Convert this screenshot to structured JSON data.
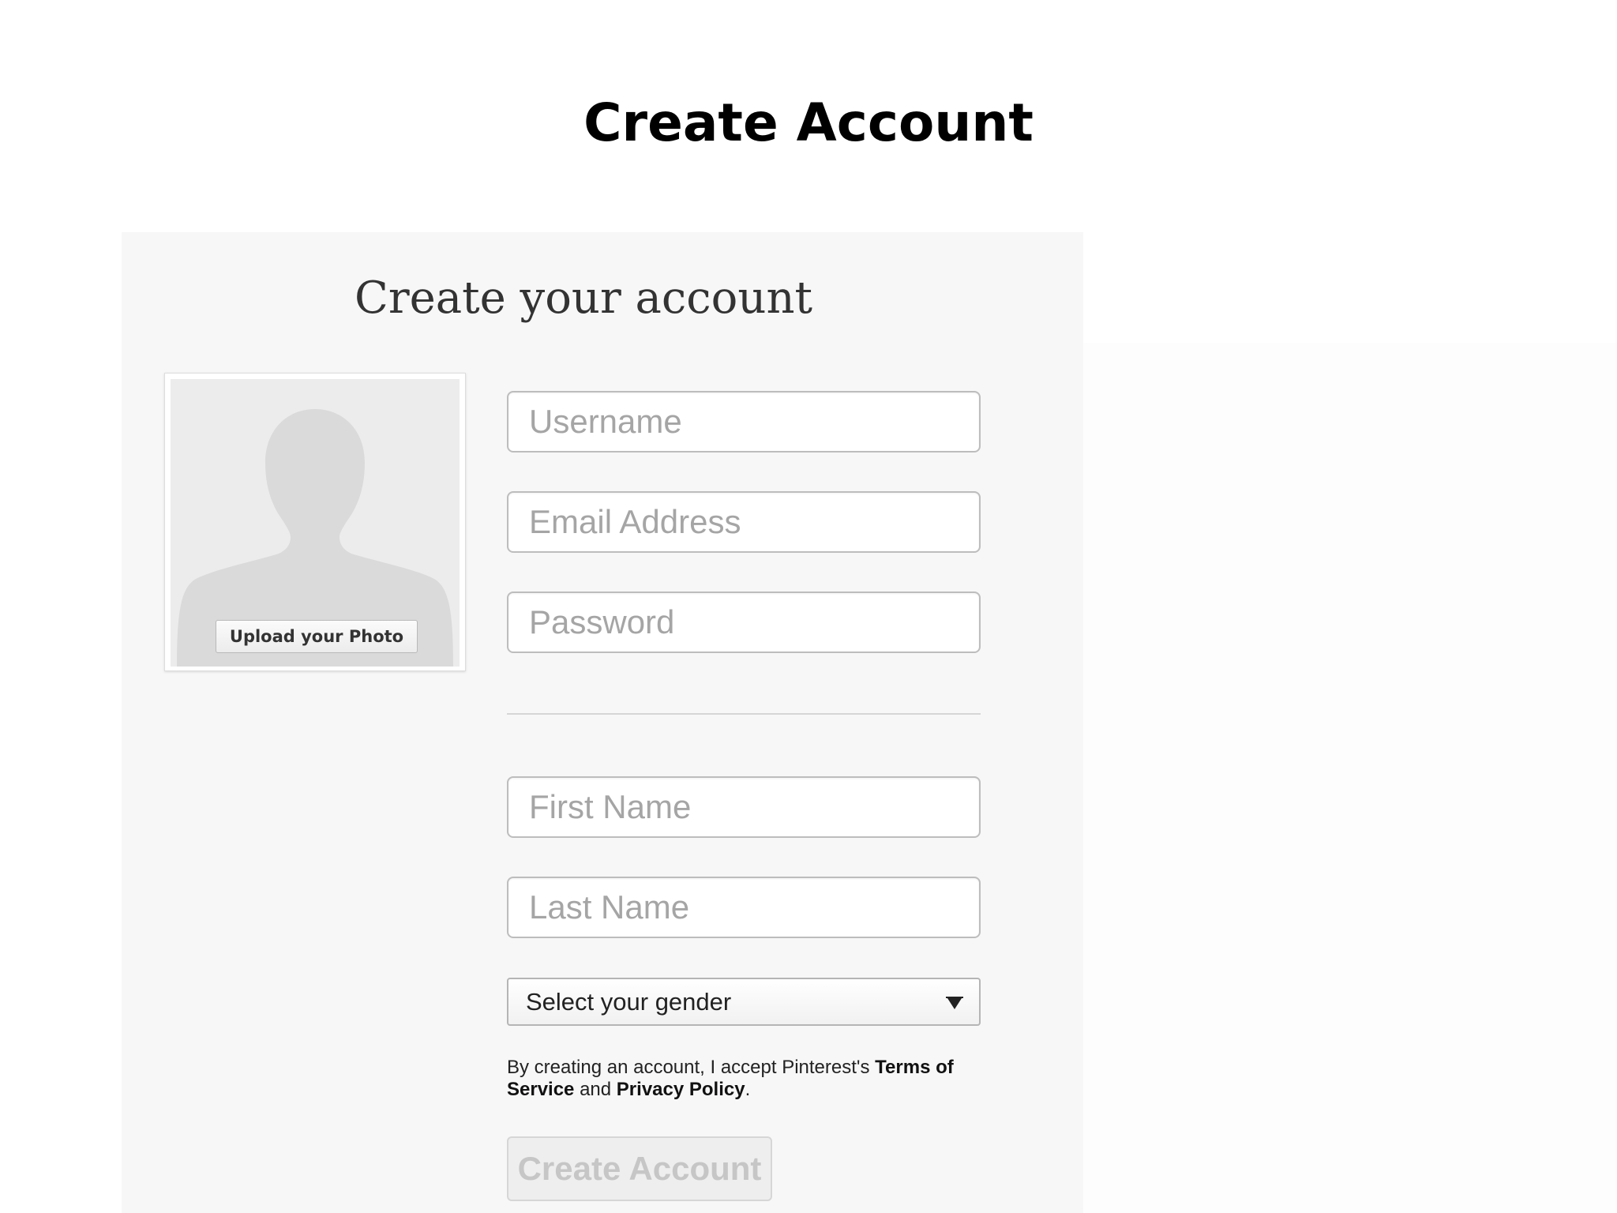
{
  "slide": {
    "title": "Create Account"
  },
  "form": {
    "heading": "Create your account",
    "photo": {
      "upload_label": "Upload your Photo",
      "placeholder_icon": "person-silhouette-icon"
    },
    "fields": {
      "username": {
        "placeholder": "Username",
        "value": ""
      },
      "email": {
        "placeholder": "Email Address",
        "value": ""
      },
      "password": {
        "placeholder": "Password",
        "value": ""
      },
      "first_name": {
        "placeholder": "First Name",
        "value": ""
      },
      "last_name": {
        "placeholder": "Last Name",
        "value": ""
      }
    },
    "gender": {
      "selected": "Select your gender",
      "icon": "dropdown-arrow-icon"
    },
    "terms": {
      "prefix": "By creating an account, I accept Pinterest's ",
      "terms_link": "Terms of Service",
      "joiner": " and ",
      "privacy_link": "Privacy Policy",
      "suffix": "."
    },
    "submit_label": "Create Account"
  },
  "colors": {
    "panel_background": "#f8f7f8",
    "field_border": "#bdbdbd",
    "placeholder_text": "#a5a5a5",
    "disabled_button_text": "#c6c6c6"
  }
}
